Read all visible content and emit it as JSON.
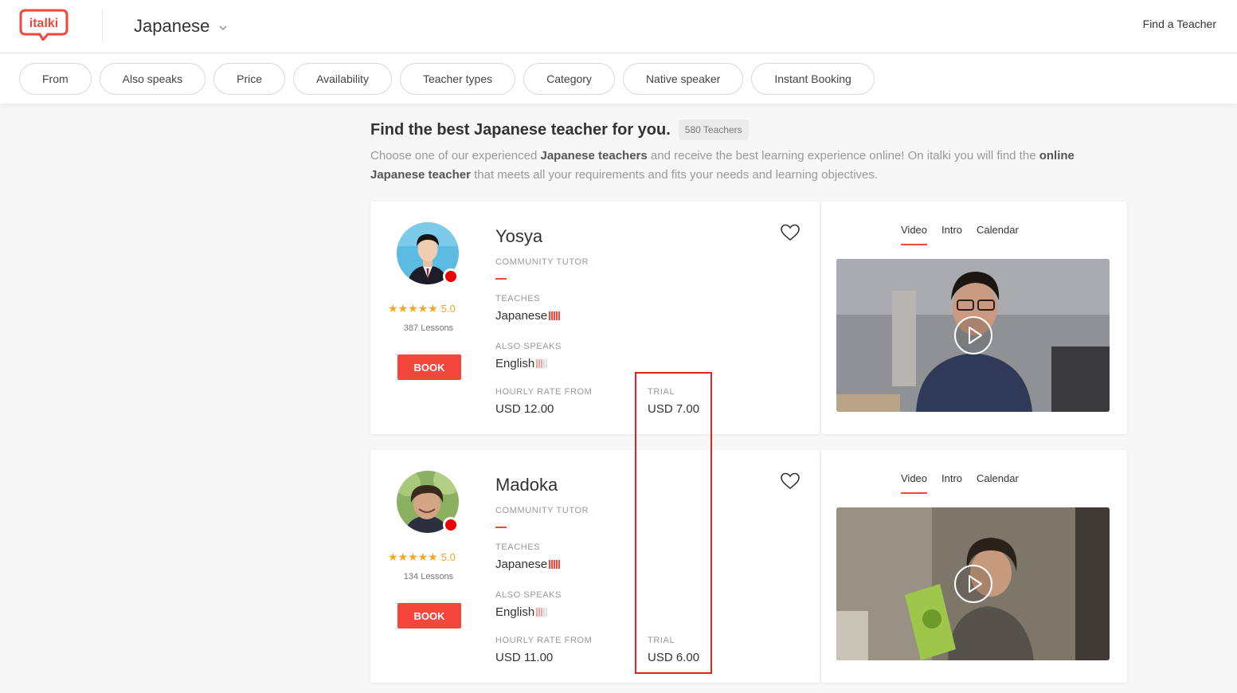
{
  "header": {
    "logo_text": "italki",
    "language": "Japanese",
    "find_teacher": "Find a Teacher"
  },
  "filters": [
    "From",
    "Also speaks",
    "Price",
    "Availability",
    "Teacher types",
    "Category",
    "Native speaker",
    "Instant Booking"
  ],
  "intro": {
    "title": "Find the best Japanese teacher for you.",
    "count": "580 Teachers",
    "desc_1": "Choose one of our experienced ",
    "desc_b1": "Japanese teachers",
    "desc_2": " and receive the best learning experience online! On italki you will find the ",
    "desc_b2": "online Japanese teacher",
    "desc_3": " that meets all your requirements and fits your needs and learning objectives."
  },
  "labels": {
    "teaches": "TEACHES",
    "also_speaks": "ALSO SPEAKS",
    "hourly": "HOURLY RATE FROM",
    "trial": "TRIAL",
    "book": "BOOK",
    "video_tab": "Video",
    "intro_tab": "Intro",
    "calendar_tab": "Calendar"
  },
  "teachers": [
    {
      "name": "Yosya",
      "type": "COMMUNITY TUTOR",
      "rating": "5.0",
      "lessons": "387 Lessons",
      "teaches": "Japanese",
      "also_speaks": "English",
      "hourly": "USD 12.00",
      "trial": "USD 7.00"
    },
    {
      "name": "Madoka",
      "type": "COMMUNITY TUTOR",
      "rating": "5.0",
      "lessons": "134 Lessons",
      "teaches": "Japanese",
      "also_speaks": "English",
      "hourly": "USD 11.00",
      "trial": "USD 6.00"
    }
  ],
  "colors": {
    "brand": "#f4473c",
    "star": "#f5a623",
    "online": "#e00000"
  }
}
